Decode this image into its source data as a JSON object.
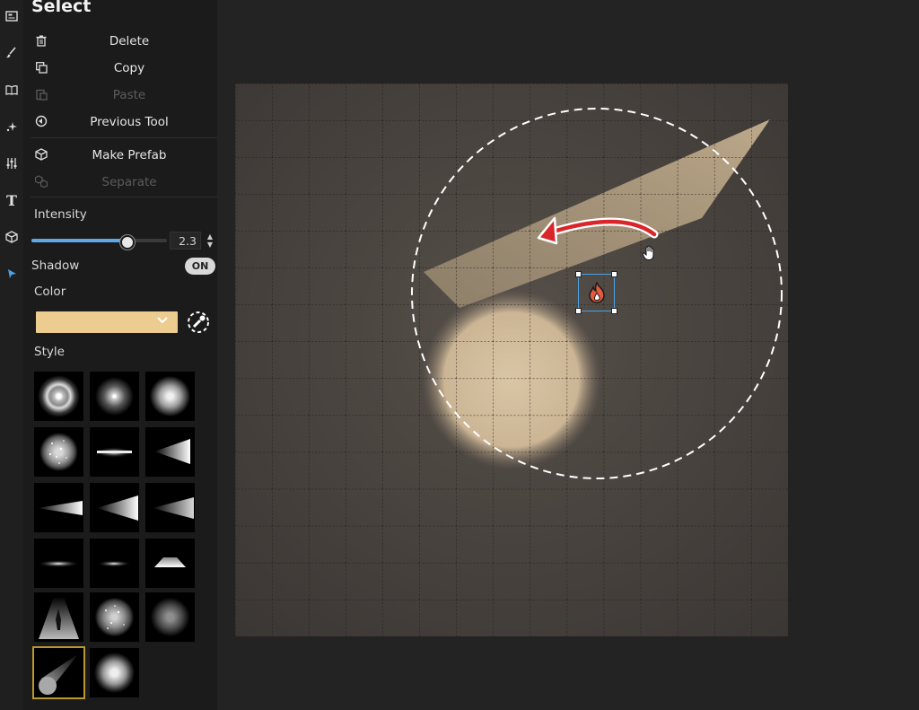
{
  "rail": {
    "items": [
      {
        "name": "layers-icon"
      },
      {
        "name": "brush-icon"
      },
      {
        "name": "book-icon"
      },
      {
        "name": "sparkle-icon"
      },
      {
        "name": "sliders-icon"
      },
      {
        "name": "text-icon",
        "glyph": "T"
      },
      {
        "name": "cube-icon"
      },
      {
        "name": "pointer-icon",
        "active": true
      }
    ]
  },
  "panel": {
    "title": "Select",
    "menu": [
      {
        "label": "Delete",
        "icon": "trash-icon",
        "enabled": true
      },
      {
        "label": "Copy",
        "icon": "copy-icon",
        "enabled": true
      },
      {
        "label": "Paste",
        "icon": "paste-icon",
        "enabled": false
      },
      {
        "label": "Previous Tool",
        "icon": "previous-tool-icon",
        "enabled": true
      },
      {
        "label": "Make Prefab",
        "icon": "prefab-icon",
        "enabled": true
      },
      {
        "label": "Separate",
        "icon": "separate-icon",
        "enabled": false
      }
    ],
    "intensity": {
      "label": "Intensity",
      "value": "2.3",
      "level_fraction": 0.7
    },
    "shadow": {
      "label": "Shadow",
      "toggle": "ON"
    },
    "color": {
      "label": "Color",
      "value": "#eccd8f"
    },
    "style": {
      "label": "Style",
      "selected_index": 15,
      "count": 17
    }
  },
  "colors": {
    "accent": "#4aa3e8",
    "selected_outline": "#b99a2a",
    "light": "#eccd8f",
    "arrow": "#d8262a"
  }
}
